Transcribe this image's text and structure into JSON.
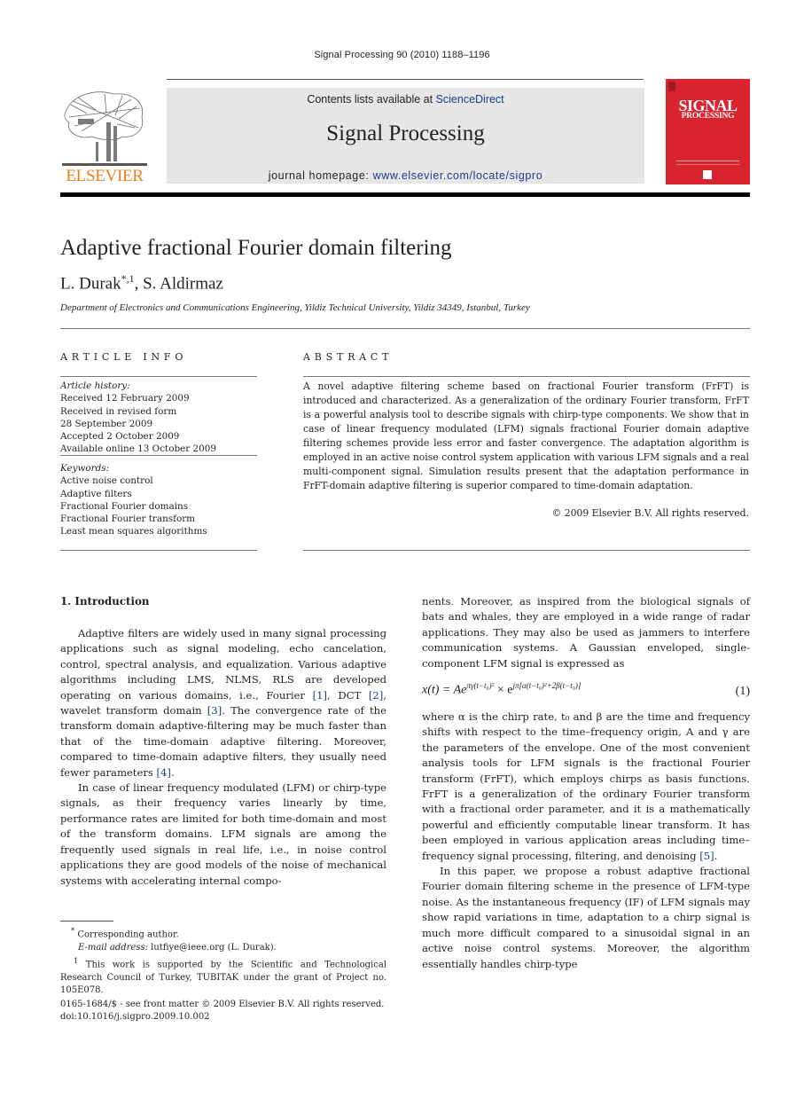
{
  "running_head": "Signal Processing 90 (2010) 1188–1196",
  "header": {
    "publisher_logo_text": "ELSEVIER",
    "contents_prefix": "Contents lists available at ",
    "contents_link": "ScienceDirect",
    "journal_title": "Signal Processing",
    "homepage_prefix": "journal homepage: ",
    "homepage_link": "www.elsevier.com/locate/sigpro",
    "cover": {
      "line1": "SIGNAL",
      "line2": "PROCESSING",
      "color": "#d9232f"
    },
    "logo_color": "#f07d1a",
    "link_color": "#1f3c88"
  },
  "article": {
    "title": "Adaptive fractional Fourier domain filtering",
    "author1": "L. Durak",
    "author1_marks": "*,1",
    "author_sep": ", ",
    "author2": "S. Aldirmaz",
    "affiliation": "Department of Electronics and Communications Engineering, Yildiz Technical University, Yildiz 34349, Istanbul, Turkey"
  },
  "article_info": {
    "heading": "ARTICLE INFO",
    "history_label": "Article history:",
    "history": [
      "Received 12 February 2009",
      "Received in revised form",
      "28 September 2009",
      "Accepted 2 October 2009",
      "Available online 13 October 2009"
    ],
    "keywords_label": "Keywords:",
    "keywords": [
      "Active noise control",
      "Adaptive filters",
      "Fractional Fourier domains",
      "Fractional Fourier transform",
      "Least mean squares algorithms"
    ]
  },
  "abstract": {
    "heading": "ABSTRACT",
    "text": "A novel adaptive filtering scheme based on fractional Fourier transform (FrFT) is introduced and characterized. As a generalization of the ordinary Fourier transform, FrFT is a powerful analysis tool to describe signals with chirp-type components. We show that in case of linear frequency modulated (LFM) signals fractional Fourier domain adaptive filtering schemes provide less error and faster convergence. The adaptation algorithm is employed in an active noise control system application with various LFM signals and a real multi-component signal. Simulation results present that the adaptation performance in FrFT-domain adaptive filtering is superior compared to time-domain adaptation.",
    "copyright": "© 2009 Elsevier B.V. All rights reserved."
  },
  "body": {
    "section_heading": "1.  Introduction",
    "left_p1_a": "Adaptive filters are widely used in many signal processing applications such as signal modeling, echo cancelation, control, spectral analysis, and equalization. Various adaptive algorithms including LMS, NLMS, RLS are developed operating on various domains, i.e., Fourier ",
    "ref1": "[1]",
    "left_p1_b": ", DCT ",
    "ref2": "[2]",
    "left_p1_c": ", wavelet transform domain ",
    "ref3": "[3]",
    "left_p1_d": ". The convergence rate of the transform domain adaptive-filtering may be much faster than that of the time-domain adaptive filtering. Moreover, compared to time-domain adaptive filters, they usually need fewer parameters ",
    "ref4": "[4]",
    "left_p1_e": ".",
    "left_p2": "In case of linear frequency modulated (LFM) or chirp-type signals, as their frequency varies linearly by time, performance rates are limited for both time-domain and most of the transform domains. LFM signals are among the frequently used signals in real life, i.e., in noise control applications they are good models of the noise of mechanical systems with accelerating internal compo-",
    "right_p1": "nents. Moreover, as inspired from the biological signals of bats and whales, they are employed in a wide range of radar applications. They may also be used as jammers to interfere communication systems. A Gaussian enveloped, single-component LFM signal is expressed as",
    "equation": {
      "lhs": "x(t) = Ae",
      "exp1": "πγ(t−t₀)²",
      "times": " × e",
      "exp2": "jπ[α(t−t₀)²+2β(t−t₀)]",
      "number": "(1)"
    },
    "right_p2_a": "where α is the chirp rate, t₀ and β are the time and frequency shifts with respect to the time–frequency origin, A and γ are the parameters of the envelope. One of the most convenient analysis tools for LFM signals is the fractional Fourier transform (FrFT), which employs chirps as basis functions. FrFT is a generalization of the ordinary Fourier transform with a fractional order parameter, and it is a mathematically powerful and efficiently computable linear transform. It has been employed in various application areas including time–frequency signal processing, filtering, and denoising ",
    "ref5": "[5]",
    "right_p2_b": ".",
    "right_p3": "In this paper, we propose a robust adaptive fractional Fourier domain filtering scheme in the presence of LFM-type noise. As the instantaneous frequency (IF) of LFM signals may show rapid variations in time, adaptation to a chirp signal is much more difficult compared to a sinusoidal signal in an active noise control systems. Moreover, the algorithm essentially handles chirp-type"
  },
  "footnotes": {
    "corresponding_mark": "*",
    "corresponding": " Corresponding author.",
    "email_label": "E-mail address:",
    "email": " lutfiye@ieee.org (L. Durak).",
    "fn1_mark": "1",
    "fn1": " This work is supported by the Scientific and Technological Research Council of Turkey, TUBITAK under the grant of Project no. 105E078."
  },
  "issn_line": "0165-1684/$ - see front matter © 2009 Elsevier B.V. All rights reserved.",
  "doi_line": "doi:10.1016/j.sigpro.2009.10.002"
}
